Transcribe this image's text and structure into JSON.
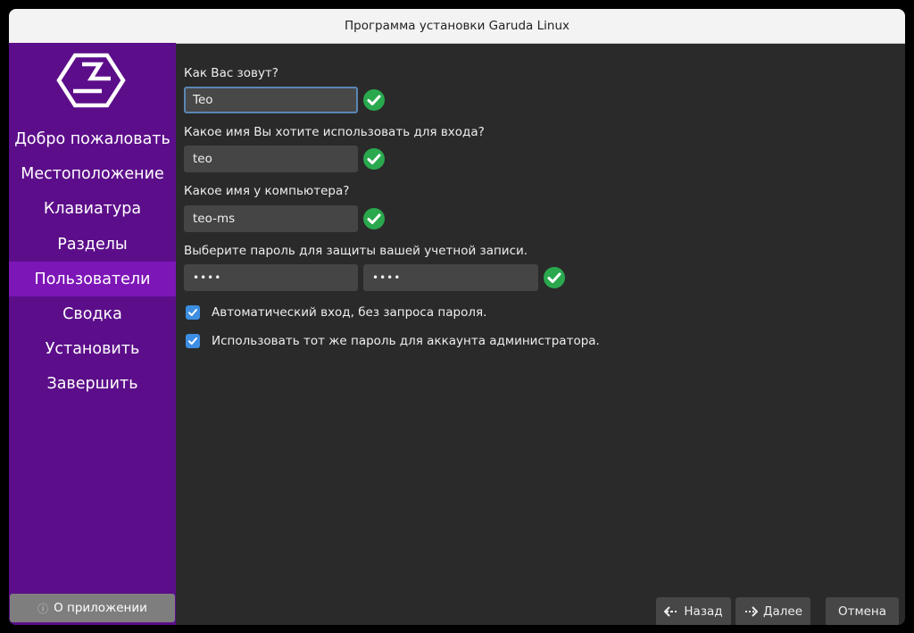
{
  "window": {
    "title": "Программа установки Garuda Linux"
  },
  "sidebar": {
    "items": [
      {
        "label": "Добро пожаловать"
      },
      {
        "label": "Местоположение"
      },
      {
        "label": "Клавиатура"
      },
      {
        "label": "Разделы"
      },
      {
        "label": "Пользователи",
        "active": true
      },
      {
        "label": "Сводка"
      },
      {
        "label": "Установить"
      },
      {
        "label": "Завершить"
      }
    ],
    "about_label": "О приложении",
    "about_icon": "info-icon"
  },
  "form": {
    "name_label": "Как Вас зовут?",
    "name_value": "Teo",
    "login_label": "Какое имя Вы хотите использовать для входа?",
    "login_value": "teo",
    "host_label": "Какое имя у компьютера?",
    "host_value": "teo-ms",
    "password_label": "Выберите пароль для защиты вашей учетной записи.",
    "password_value": "••••",
    "password_confirm_value": "••••",
    "autologin_label": "Автоматический вход, без запроса пароля.",
    "autologin_checked": true,
    "same_password_label": "Использовать тот же пароль для аккаунта администратора.",
    "same_password_checked": true
  },
  "buttons": {
    "back_label": "Назад",
    "next_label": "Далее",
    "cancel_label": "Отмена"
  },
  "colors": {
    "sidebar_bg": "#5c0e8a",
    "sidebar_active": "#7d16b7",
    "valid_check": "#2aa84e",
    "checkbox": "#3d8ee2",
    "focus_border": "#5a87b4"
  }
}
